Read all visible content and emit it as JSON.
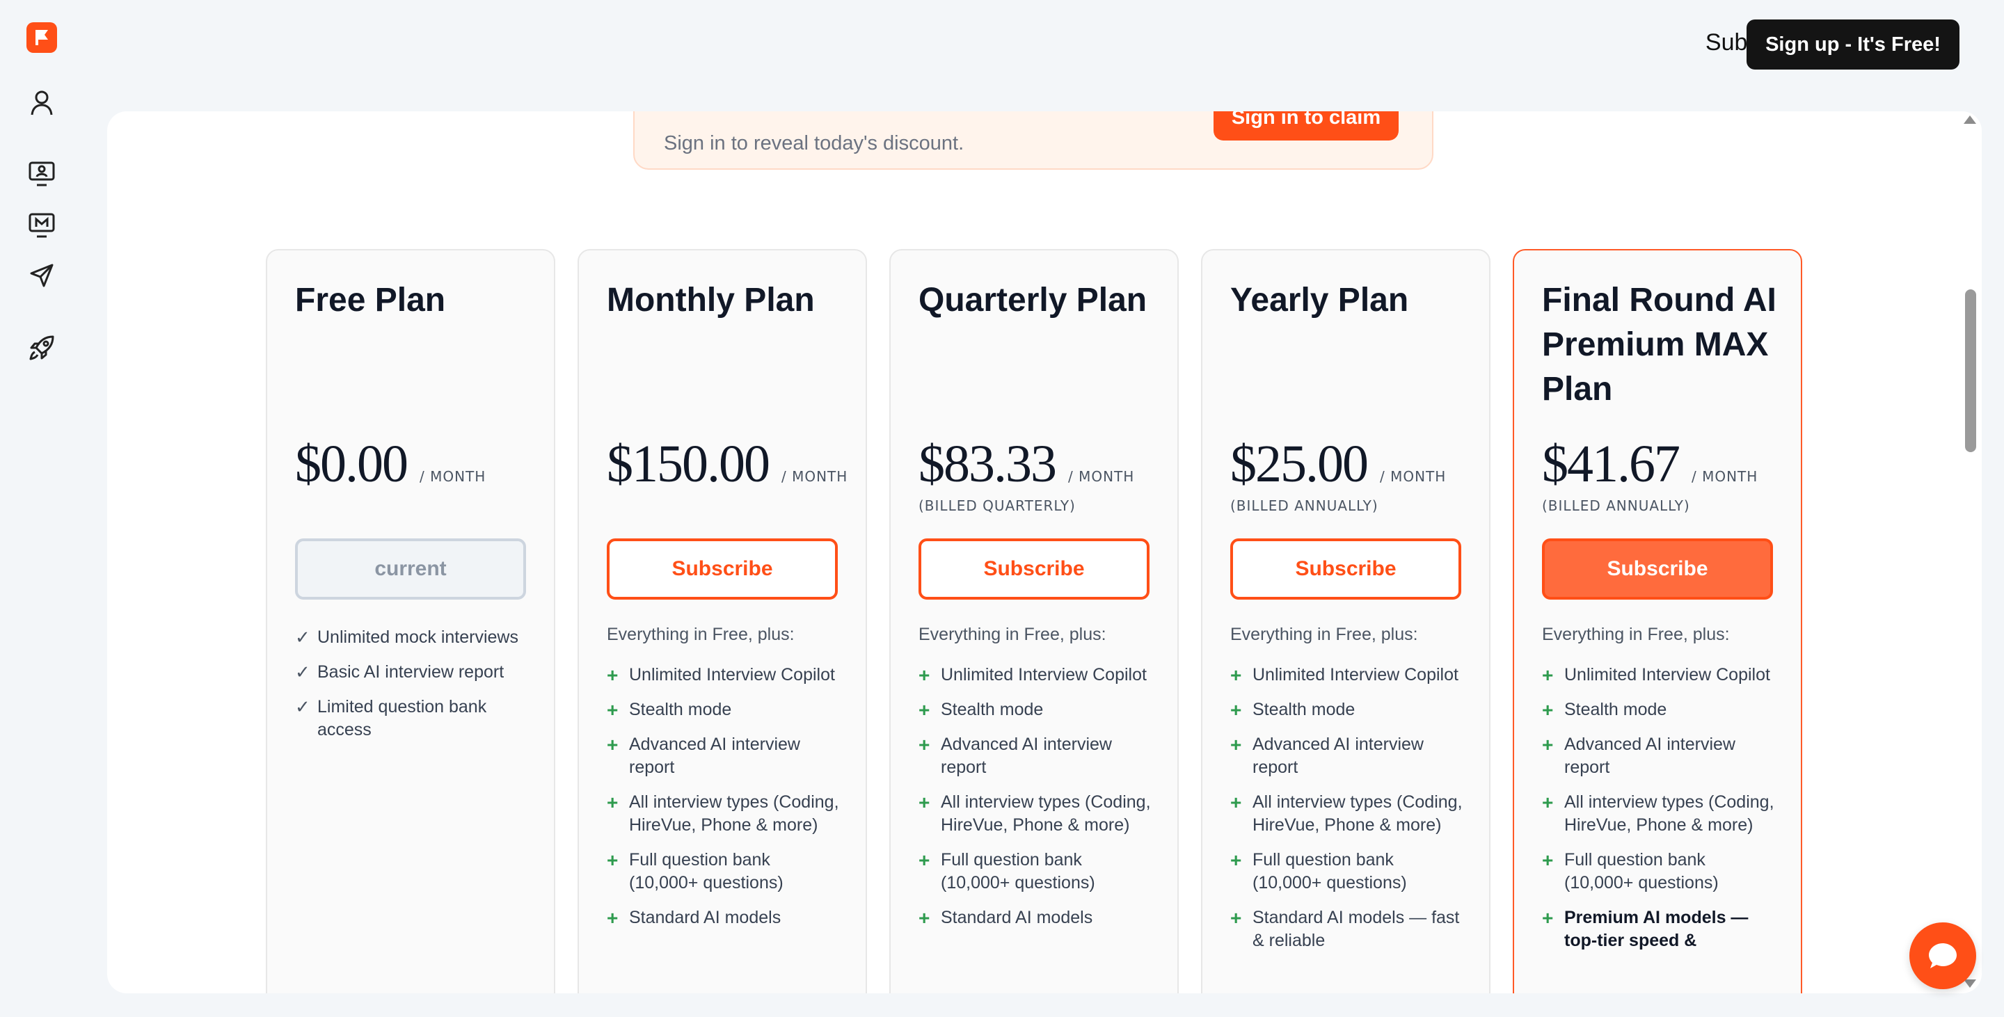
{
  "header": {
    "subscription_link": "Subscription",
    "signup_button": "Sign up - It's Free!"
  },
  "rail": {
    "items": [
      {
        "icon": "profile-icon"
      },
      {
        "icon": "monitor-user-icon"
      },
      {
        "icon": "monitor-m-icon"
      },
      {
        "icon": "paper-plane-icon"
      },
      {
        "icon": "rocket-icon"
      }
    ]
  },
  "promo": {
    "text": "Sign in to reveal today's discount.",
    "button": "Sign in to claim"
  },
  "plans": [
    {
      "title": "Free Plan",
      "price": "$0.00",
      "per": "/ MONTH",
      "billed": "",
      "cta": "current",
      "intro": "",
      "features": [
        "Unlimited mock interviews",
        "Basic AI interview report",
        "Limited question bank access"
      ]
    },
    {
      "title": "Monthly Plan",
      "price": "$150.00",
      "per": "/ MONTH",
      "billed": "",
      "cta": "Subscribe",
      "intro": "Everything in Free, plus:",
      "features": [
        "Unlimited Interview Copilot",
        "Stealth mode",
        "Advanced AI interview report",
        "All interview types (Coding, HireVue, Phone & more)",
        "Full question bank (10,000+ questions)",
        "Standard AI models"
      ]
    },
    {
      "title": "Quarterly Plan",
      "price": "$83.33",
      "per": "/ MONTH",
      "billed": "(BILLED QUARTERLY)",
      "cta": "Subscribe",
      "intro": "Everything in Free, plus:",
      "features": [
        "Unlimited Interview Copilot",
        "Stealth mode",
        "Advanced AI interview report",
        "All interview types (Coding, HireVue, Phone & more)",
        "Full question bank (10,000+ questions)",
        "Standard AI models"
      ]
    },
    {
      "title": "Yearly Plan",
      "price": "$25.00",
      "per": "/ MONTH",
      "billed": "(BILLED ANNUALLY)",
      "cta": "Subscribe",
      "intro": "Everything in Free, plus:",
      "features": [
        "Unlimited Interview Copilot",
        "Stealth mode",
        "Advanced AI interview report",
        "All interview types (Coding, HireVue, Phone & more)",
        "Full question bank (10,000+ questions)",
        "Standard AI models — fast & reliable"
      ]
    },
    {
      "title": "Final Round AI Premium MAX Plan",
      "price": "$41.67",
      "per": "/ MONTH",
      "billed": "(BILLED ANNUALLY)",
      "cta": "Subscribe",
      "intro": "Everything in Free, plus:",
      "features": [
        "Unlimited Interview Copilot",
        "Stealth mode",
        "Advanced AI interview report",
        "All interview types (Coding, HireVue, Phone & more)",
        "Full question bank (10,000+ questions)",
        "Premium AI models — top-tier speed &"
      ]
    }
  ],
  "colors": {
    "accent": "#ff4f17",
    "plus_green": "#2e9b4e"
  }
}
